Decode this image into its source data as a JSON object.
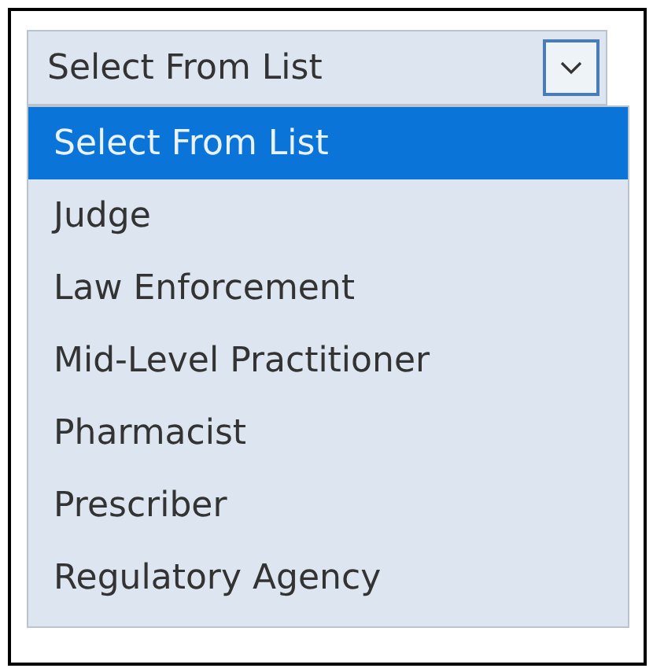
{
  "select": {
    "value": "Select From List"
  },
  "options": [
    {
      "label": "Select From List",
      "selected": true
    },
    {
      "label": "Judge",
      "selected": false
    },
    {
      "label": "Law Enforcement",
      "selected": false
    },
    {
      "label": "Mid-Level Practitioner",
      "selected": false
    },
    {
      "label": "Pharmacist",
      "selected": false
    },
    {
      "label": "Prescriber",
      "selected": false
    },
    {
      "label": "Regulatory Agency",
      "selected": false
    }
  ]
}
